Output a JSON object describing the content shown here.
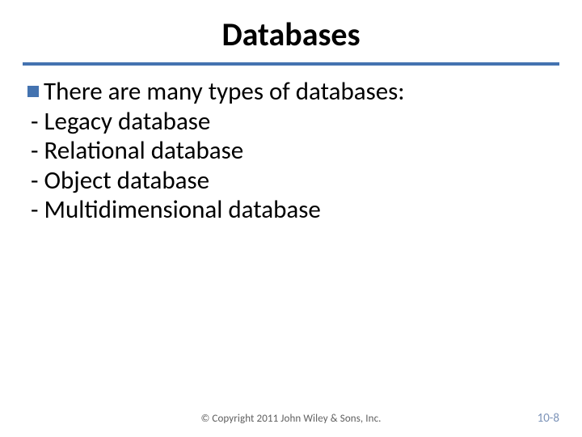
{
  "title": "Databases",
  "lead": "There are many types of databases:",
  "subitems": [
    "- Legacy database",
    "- Relational database",
    "- Object database",
    "- Multidimensional database"
  ],
  "footer": {
    "copyright": "© Copyright 2011 John Wiley & Sons, Inc.",
    "page": "10-8"
  },
  "colors": {
    "accent": "#4473b0"
  }
}
